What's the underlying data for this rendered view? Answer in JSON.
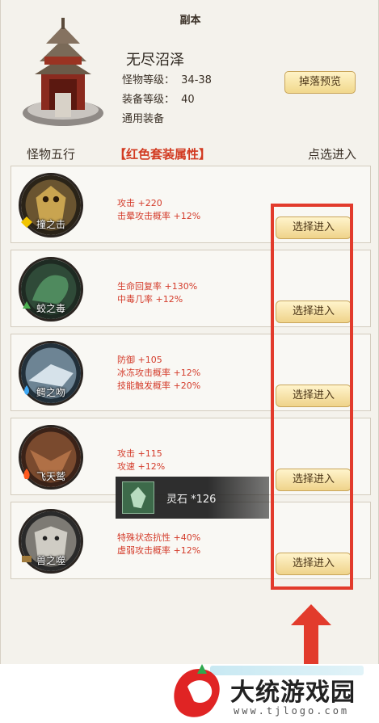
{
  "page": {
    "title": "副本"
  },
  "dungeon": {
    "name": "无尽沼泽",
    "monster_level_label": "怪物等级：",
    "monster_level": "34-38",
    "equip_level_label": "装备等级：",
    "equip_level": "40",
    "equip_type": "通用装备",
    "drop_preview_label": "掉落预览"
  },
  "headers": {
    "col1": "怪物五行",
    "col2": "【红色套装属性】",
    "col3": "点选进入"
  },
  "enter_label": "选择进入",
  "monsters": [
    {
      "name": "撞之击",
      "attrs": [
        "攻击 +220",
        "击晕攻击概率 +12%"
      ],
      "icon": "gold-element-icon"
    },
    {
      "name": "蛟之毒",
      "attrs": [
        "生命回复率 +130%",
        "中毒几率 +12%"
      ],
      "icon": "wood-element-icon"
    },
    {
      "name": "鳄之吻",
      "attrs": [
        "防御 +105",
        "冰冻攻击概率 +12%",
        "技能触发概率 +20%"
      ],
      "icon": "water-element-icon"
    },
    {
      "name": "飞天鹫",
      "attrs": [
        "攻击 +115",
        "攻速 +12%"
      ],
      "icon": "fire-element-icon"
    },
    {
      "name": "兽之噬",
      "attrs": [
        "特殊状态抗性 +40%",
        "虚弱攻击概率 +12%"
      ],
      "icon": "earth-element-icon"
    }
  ],
  "tooltip": {
    "item": "灵石 *126",
    "icon": "spirit-stone-icon"
  },
  "watermark": {
    "name": "大统游戏园",
    "url": "www.tjlogo.com"
  },
  "colors": {
    "accent_red": "#e23b2c",
    "attr_red": "#d43c2b",
    "button_gold": "#efd38a"
  }
}
